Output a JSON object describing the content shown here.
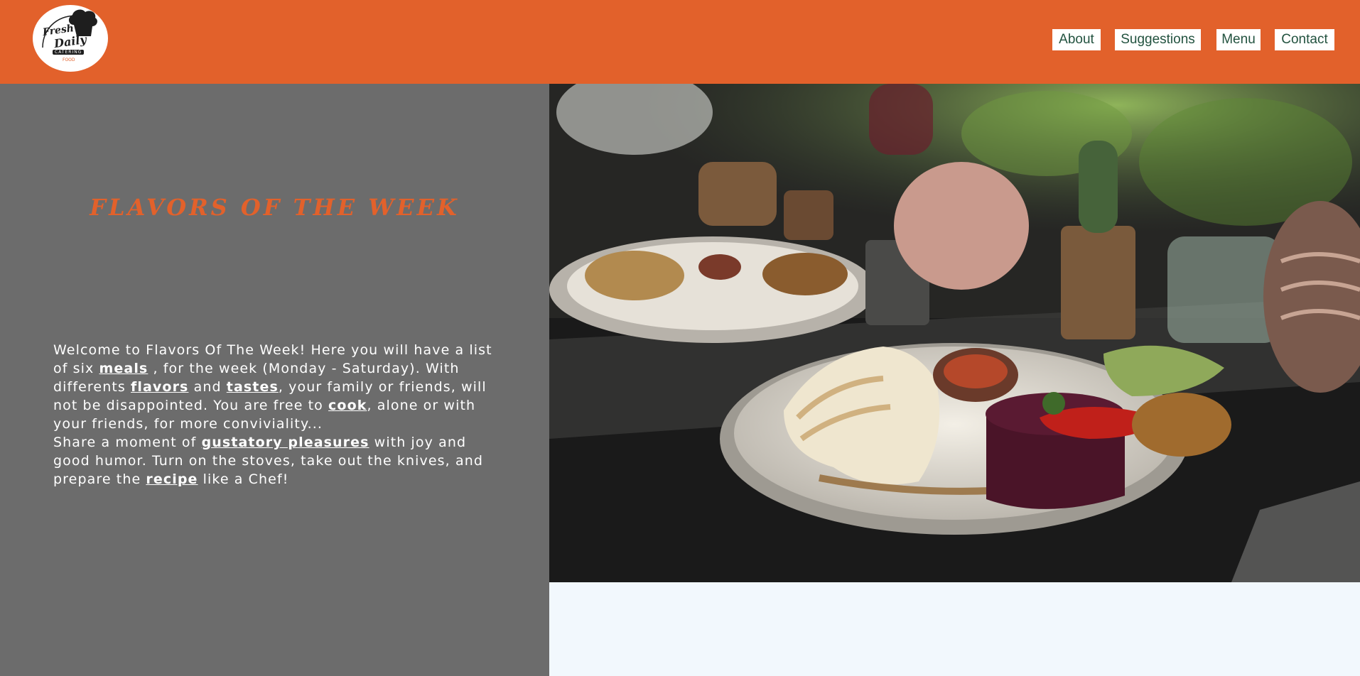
{
  "logo": {
    "line1": "Fresh",
    "line2": "Daily",
    "line3": "CATERING",
    "line4": "FOOD"
  },
  "nav": [
    {
      "label": "About"
    },
    {
      "label": "Suggestions"
    },
    {
      "label": "Menu"
    },
    {
      "label": "Contact"
    }
  ],
  "title": "FLAVORS OF THE WEEK",
  "intro": {
    "s1": "Welcome to Flavors Of The Week! Here you will have a list of six ",
    "l1": "meals",
    "s2": " , for the week (Monday - Saturday). With differents ",
    "l2": "flavors",
    "s3": " and ",
    "l3": "tastes",
    "s4": ", your family or friends, will not be disappointed. You are free to ",
    "l4": "cook",
    "s5": ", alone or with your friends, for more conviviality...",
    "s6": "Share a moment of ",
    "l5": "gustatory pleasures",
    "s7": " with joy and good humor. Turn on the stoves, take out the knives, and prepare the ",
    "l6": "recipe",
    "s8": " like a Chef!"
  },
  "colors": {
    "header": "#e2612b",
    "panel": "#6c6c6c",
    "nav_text": "#22523f",
    "page_bg": "#f2f8fd"
  }
}
